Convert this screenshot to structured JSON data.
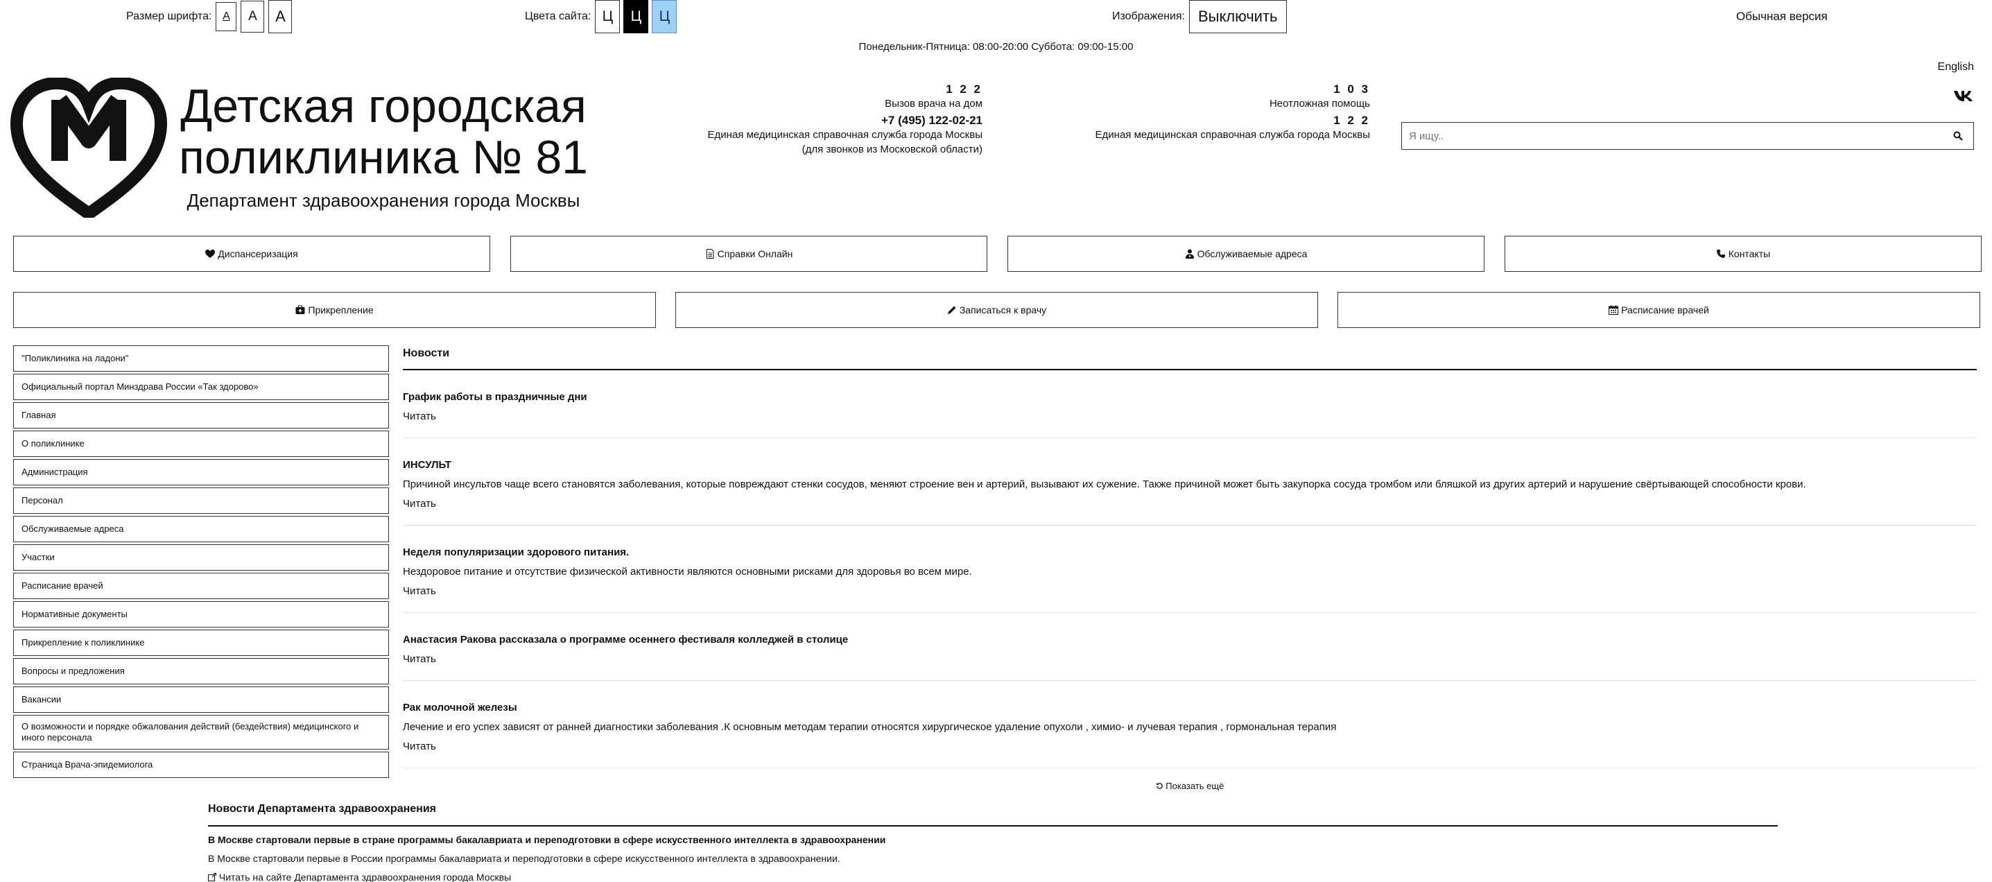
{
  "accessibility": {
    "font_size_label": "Размер шрифта:",
    "font_sizes": [
      "А",
      "А",
      "А"
    ],
    "colors_label": "Цвета сайта:",
    "color_buttons": [
      "Ц",
      "Ц",
      "Ц"
    ],
    "images_label": "Изображения:",
    "images_toggle": "Выключить",
    "normal_version": "Обычная версия"
  },
  "hours": "Понедельник-Пятница: 08:00-20:00 Суббота: 09:00-15:00",
  "english": "English",
  "vk_icon_text": "vk",
  "header": {
    "title_line1": "Детская городская",
    "title_line2": "поликлиника № 81",
    "department": "Департамент здравоохранения города Москвы"
  },
  "phones": {
    "left": {
      "num1": "1 2 2",
      "desc1": "Вызов врача на дом",
      "num2": "+7 (495) 122-02-21",
      "desc2a": "Единая медицинская справочная служба города Москвы",
      "desc2b": "(для звонков из Московской области)"
    },
    "right": {
      "num1": "1 0 3",
      "desc1": "Неотложная помощь",
      "num2": "1 2 2",
      "desc2": "Единая медицинская справочная служба города Москвы"
    }
  },
  "search": {
    "placeholder": "Я ищу.."
  },
  "nav_row1": [
    "Диспансеризация",
    "Справки Онлайн",
    "Обслуживаемые адреса",
    "Контакты"
  ],
  "nav_row2": [
    "Прикрепление",
    "Записаться к врачу",
    "Расписание врачей"
  ],
  "sidebar": [
    "\"Поликлиника на ладони\"",
    "Официальный портал Минздрава России «Так здорово»",
    "Главная",
    "О поликлинике",
    "Администрация",
    "Персонал",
    "Обслуживаемые адреса",
    "Участки",
    "Расписание врачей",
    "Нормативные документы",
    "Прикрепление к поликлинике",
    "Вопросы и предложения",
    "Вакансии",
    "О возможности и порядке обжалования действий (бездействия) медицинского и иного персонала",
    "Страница Врача-эпидемиолога"
  ],
  "news": {
    "heading": "Новости",
    "items": [
      {
        "title": "График работы в праздничные дни",
        "desc": "",
        "read": "Читать"
      },
      {
        "title": "ИНСУЛЬТ",
        "desc": "Причиной инсультов чаще всего становятся заболевания, которые повреждают стенки сосудов, меняют строение вен и артерий, вызывают их сужение. Также причиной может быть закупорка сосуда тромбом или бляшкой из других артерий и нарушение свёртывающей способности крови.",
        "read": "Читать"
      },
      {
        "title": "Неделя популяризации здорового питания.",
        "desc": "Нездоровое питание и отсутствие физической активности являются основными рисками для здоровья во всем мире.",
        "read": "Читать"
      },
      {
        "title": "Анастасия Ракова рассказала о программе осеннего фестиваля колледжей в столице",
        "desc": "",
        "read": "Читать"
      },
      {
        "title": "Рак молочной железы",
        "desc": "Лечение и его успех зависят от ранней диагностики заболевания .К основным методам терапии относятся хирургическое удаление опухоли , химио- и лучевая терапия , гормональная терапия",
        "read": "Читать"
      }
    ],
    "show_more": "Показать ещё"
  },
  "dept_news": {
    "heading": "Новости Департамента здравоохранения",
    "title": "В Москве стартовали первые в стране программы бакалавриата и переподготовки в сфере искусственного интеллекта в здравоохранении",
    "desc": "В Москве стартовали первые в России программы бакалавриата и переподготовки в сфере искусственного интеллекта в здравоохранении.",
    "read": "Читать на сайте Департамента здравоохранения города Москвы"
  },
  "colors": {
    "blue_button": "#9dd1f5",
    "border": "#333333"
  }
}
